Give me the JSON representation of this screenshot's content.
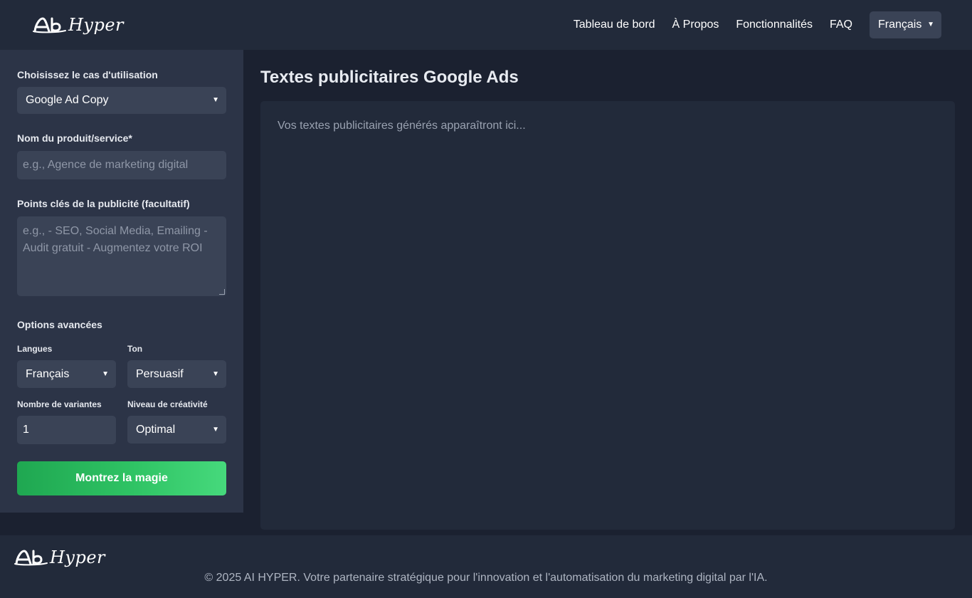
{
  "header": {
    "logo_text": "Hyper",
    "nav": [
      "Tableau de bord",
      "À Propos",
      "Fonctionnalités",
      "FAQ"
    ],
    "language": "Français"
  },
  "sidebar": {
    "use_case_label": "Choisissez le cas d'utilisation",
    "use_case_value": "Google Ad Copy",
    "product_label": "Nom du produit/service*",
    "product_placeholder": "e.g., Agence de marketing digital",
    "points_label": "Points clés de la publicité (facultatif)",
    "points_placeholder": "e.g., - SEO, Social Media, Emailing - Audit gratuit - Augmentez votre ROI",
    "advanced_label": "Options avancées",
    "languages_label": "Langues",
    "languages_value": "Français",
    "tone_label": "Ton",
    "tone_value": "Persuasif",
    "variants_label": "Nombre de variantes",
    "variants_value": "1",
    "creativity_label": "Niveau de créativité",
    "creativity_value": "Optimal",
    "submit_label": "Montrez la magie"
  },
  "main": {
    "title": "Textes publicitaires Google Ads",
    "output_placeholder": "Vos textes publicitaires générés apparaîtront ici..."
  },
  "footer": {
    "logo_text": "Hyper",
    "copyright": "© 2025 AI HYPER. Votre partenaire stratégique pour l'innovation et l'automatisation du marketing digital par l'IA."
  },
  "colors": {
    "background": "#1b2130",
    "header": "#222a3a",
    "sidebar": "#2c3447",
    "field": "#3a4356",
    "accent_green": "#2fc364"
  }
}
